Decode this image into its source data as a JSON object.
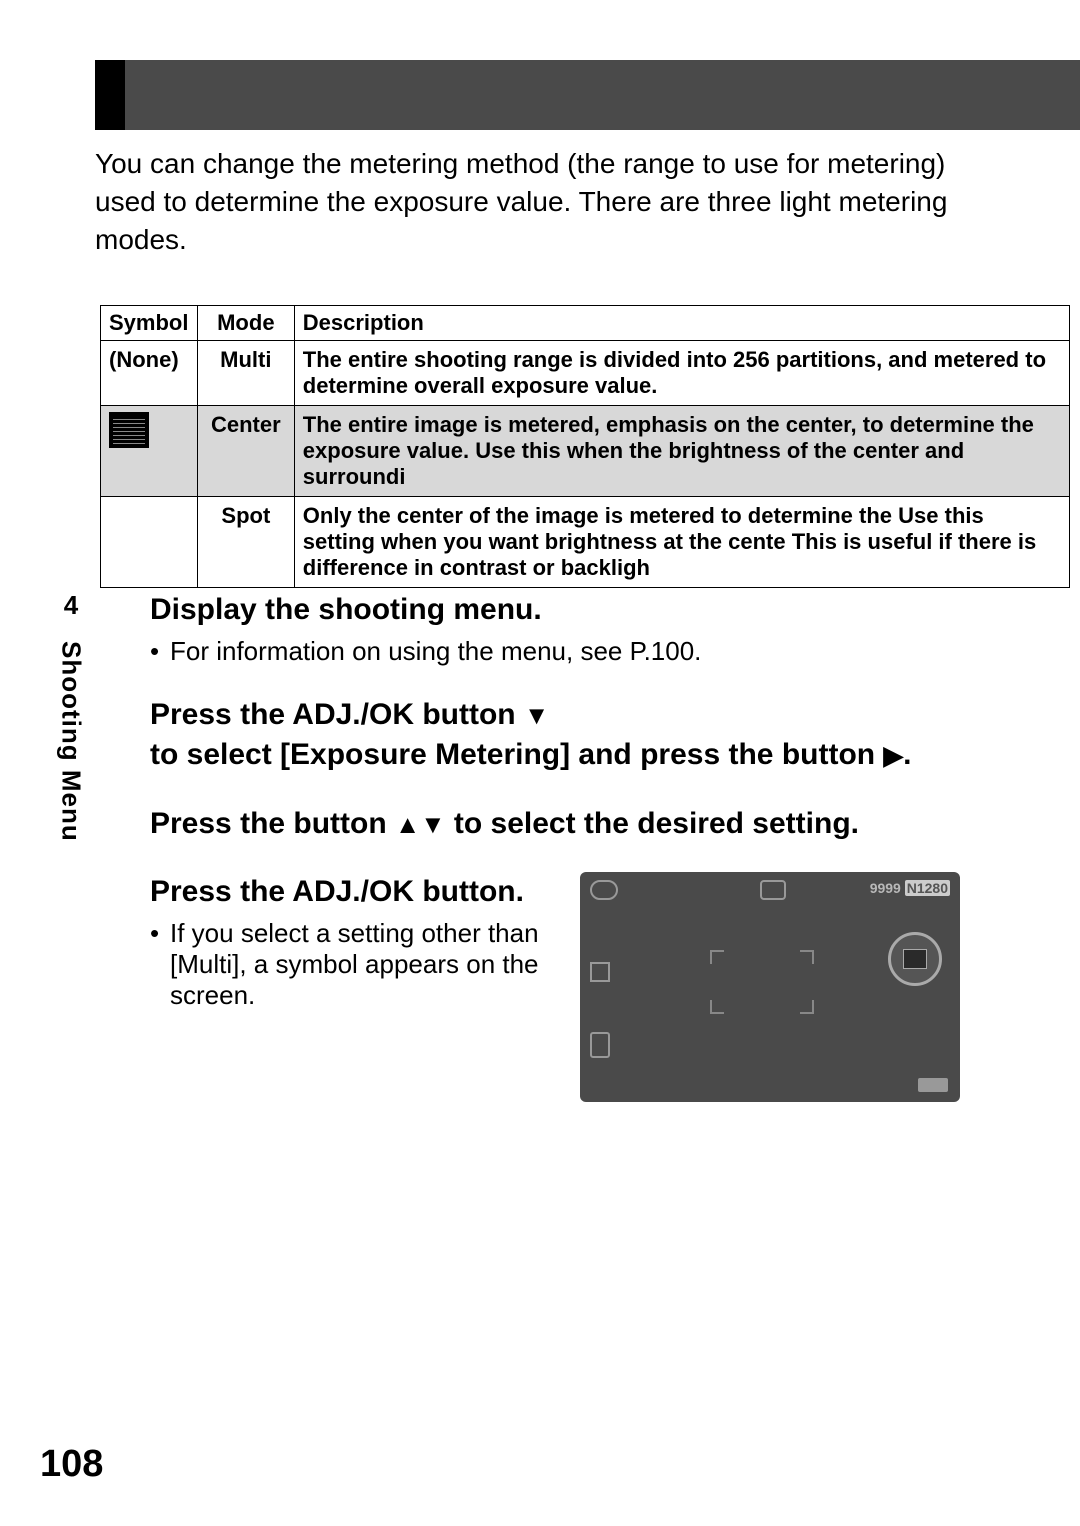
{
  "page": {
    "number": "108",
    "chapter_num": "4",
    "chapter_title": "Shooting Menu"
  },
  "intro": "You can change the metering method (the range to use for metering) used to determine the exposure value.\nThere are three light metering modes.",
  "table": {
    "headers": {
      "symbol": "Symbol",
      "mode": "Mode",
      "description": "Description"
    },
    "rows": [
      {
        "symbol_text": "(None)",
        "mode": "Multi",
        "desc_html": "The entire shooting range is divided into 256 partitions, and metered to determine overall exposure value."
      },
      {
        "has_icon": true,
        "mode": "Center",
        "desc_html": "The entire image is metered, emphasis on the center, to determine the exposure value.\nUse this when the brightness of the center and surroundi"
      },
      {
        "symbol_text": "",
        "mode": "Spot",
        "desc_html": "Only the center of the image is metered to determine the\nUse this setting when you want brightness at the cente\nThis is useful if there is difference in contrast or backligh"
      }
    ]
  },
  "steps": {
    "s1": {
      "title": "Display the shooting menu.",
      "bullet": "For information on using the menu, see P.100."
    },
    "s2": {
      "title_l1": "Press the ADJ./OK button ",
      "title_l2": "to select [Exposure Metering] and press the button "
    },
    "s3": {
      "title_l1": "Press the button ",
      "title_l2": " to select the desired setting."
    },
    "s4": {
      "title": "Press the ADJ./OK button.",
      "bullet": "If you select a setting other than [Multi], a symbol appears on the screen."
    }
  },
  "screen": {
    "counter": "9999",
    "size": "N1280"
  }
}
